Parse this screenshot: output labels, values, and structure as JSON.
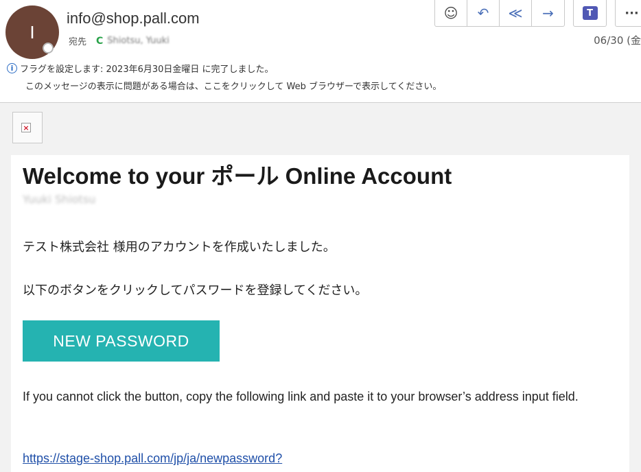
{
  "header": {
    "avatar_initial": "I",
    "sender": "info@shop.pall.com",
    "to_label": "宛先",
    "to_status_icon": "C",
    "to_name": "Shiotsu, Yuuki",
    "date": "06/30 (金",
    "toolbar": {
      "emoji": "☺",
      "reply": "↶",
      "reply_all": "≪",
      "forward": "→",
      "teams": "T",
      "more": "···"
    },
    "info_icon": "i",
    "flag_text": "フラグを設定します: 2023年6月30日金曜日 に完了しました。",
    "browser_notice": "このメッセージの表示に問題がある場合は、ここをクリックして Web ブラウザーで表示してください。"
  },
  "body": {
    "broken_image_icon": "×",
    "title": "Welcome to your ポール Online Account",
    "subtitle": "Yuuki Shiotsu",
    "paragraph1": "テスト株式会社 様用のアカウントを作成いたしました。",
    "paragraph2": "以下のボタンをクリックしてパスワードを登録してください。",
    "button_label": "NEW PASSWORD",
    "paragraph3": "If you cannot click the button, copy the following link and paste it to your browser’s address input field.",
    "link": "https://stage-shop.pall.com/jp/ja/newpassword?"
  },
  "colors": {
    "avatar": "#6b4336",
    "button": "#25b3b1",
    "link": "#1f4fa8",
    "presence": "#2aa24a",
    "teams": "#5058b4"
  }
}
